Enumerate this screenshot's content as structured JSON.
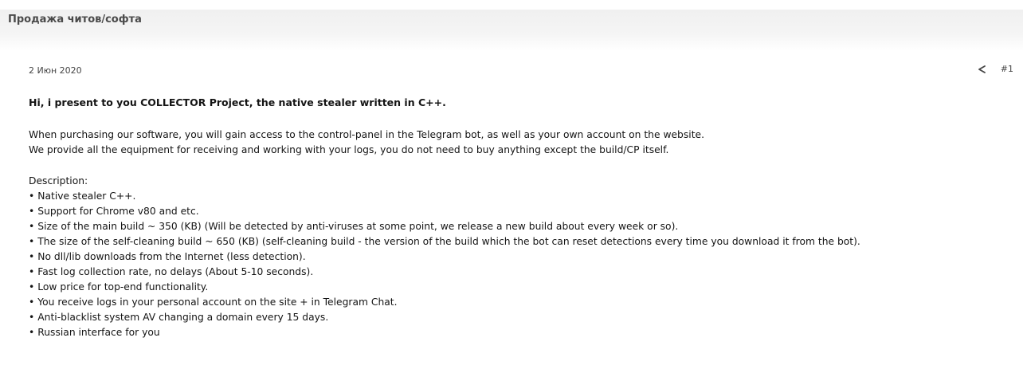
{
  "forum": {
    "title": "Продажа читов/софта"
  },
  "post": {
    "date": "2 Июн 2020",
    "number": "#1",
    "share_icon": "share-icon",
    "headline": "Hi, i present to you COLLECTOR Project, the native stealer written in C++.",
    "paragraph_1": "When purchasing our software, you will gain access to the control-panel in the Telegram bot, as well as your own account on the website.",
    "paragraph_2": "We provide all the equipment for receiving and working with your logs, you do not need to buy anything except the build/CP itself.",
    "description_label": "Description:",
    "features": [
      "Native stealer C++.",
      "Support for Chrome v80 and etc.",
      "Size of the main build ~ 350 (KB) (Will be detected by anti-viruses at some point, we release a new build about every week or so).",
      "The size of the self-cleaning build ~ 650 (KB) (self-cleaning build - the version of the build which the bot can reset detections every time you download it from the bot).",
      "No dll/lib downloads from the Internet (less detection).",
      "Fast log collection rate, no delays (About 5-10 seconds).",
      "Low price for top-end functionality.",
      "You receive logs in your personal account on the site + in Telegram Chat.",
      "Anti-blacklist system AV changing a domain every 15 days.",
      "Russian interface for you"
    ]
  }
}
